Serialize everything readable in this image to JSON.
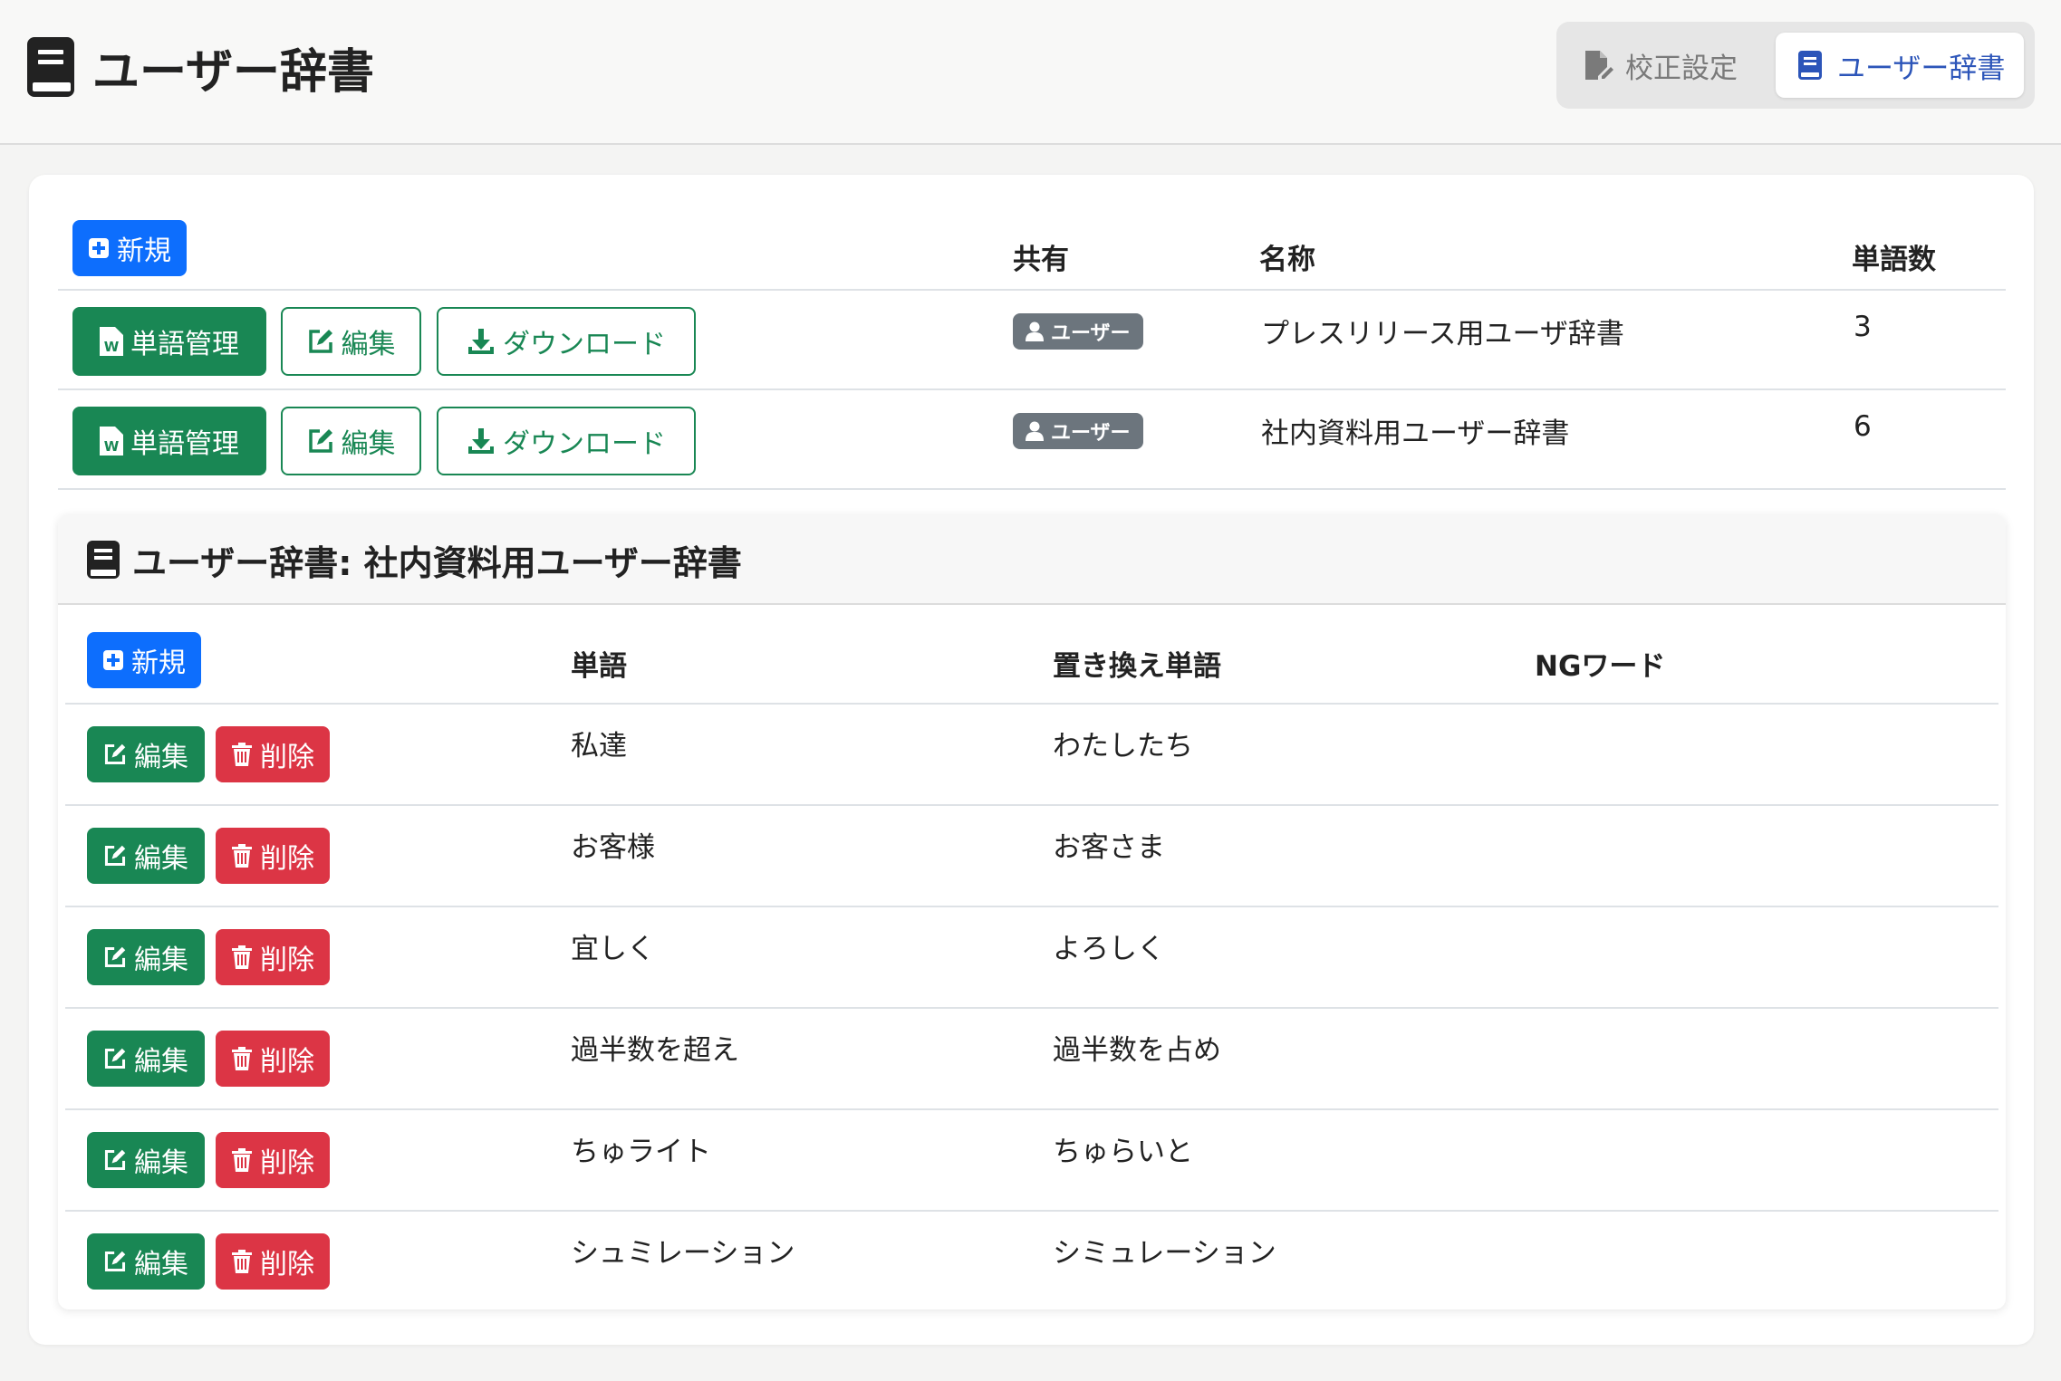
{
  "header": {
    "title": "ユーザー辞書",
    "icon": "book-icon",
    "nav": [
      {
        "label": "校正設定",
        "icon": "file-pen-icon",
        "active": false
      },
      {
        "label": "ユーザー辞書",
        "icon": "book-icon",
        "active": true
      }
    ]
  },
  "dictionaries": {
    "new_label": "新規",
    "columns": {
      "share": "共有",
      "name": "名称",
      "count": "単語数"
    },
    "row_actions": {
      "manage": "単語管理",
      "edit": "編集",
      "download": "ダウンロード"
    },
    "rows": [
      {
        "share": "ユーザー",
        "name": "プレスリリース用ユーザ辞書",
        "count": "3"
      },
      {
        "share": "ユーザー",
        "name": "社内資料用ユーザー辞書",
        "count": "6"
      }
    ]
  },
  "words": {
    "title": "ユーザー辞書: 社内資料用ユーザー辞書",
    "new_label": "新規",
    "columns": {
      "word": "単語",
      "replacement": "置き換え単語",
      "ng": "NGワード"
    },
    "row_actions": {
      "edit": "編集",
      "delete": "削除"
    },
    "rows": [
      {
        "word": "私達",
        "replacement": "わたしたち",
        "ng": ""
      },
      {
        "word": "お客様",
        "replacement": "お客さま",
        "ng": ""
      },
      {
        "word": "宜しく",
        "replacement": "よろしく",
        "ng": ""
      },
      {
        "word": "過半数を超え",
        "replacement": "過半数を占め",
        "ng": ""
      },
      {
        "word": "ちゅライト",
        "replacement": "ちゅらいと",
        "ng": ""
      },
      {
        "word": "シュミレーション",
        "replacement": "シミュレーション",
        "ng": ""
      }
    ]
  },
  "colors": {
    "primary": "#0d6efd",
    "success": "#198754",
    "danger": "#dc3545",
    "secondary": "#6c757d",
    "nav_active": "#2c55b9"
  }
}
